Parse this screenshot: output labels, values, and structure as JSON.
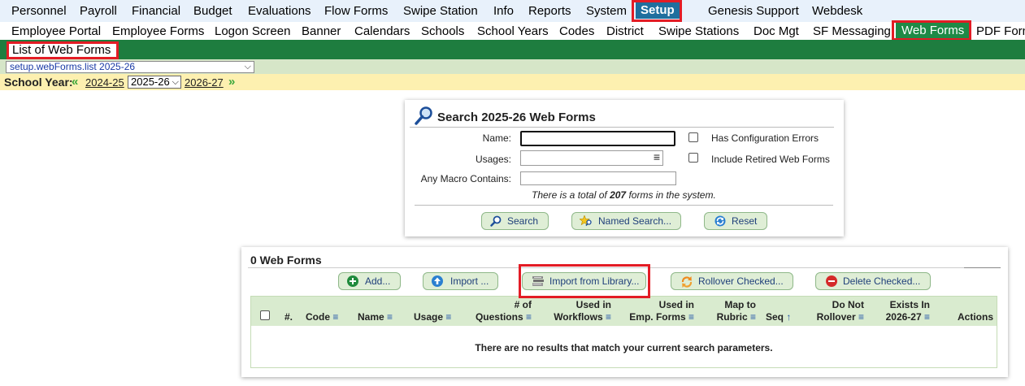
{
  "top_menu": [
    {
      "label": "Personnel"
    },
    {
      "label": "Payroll"
    },
    {
      "label": "Financial"
    },
    {
      "label": "Budget"
    },
    {
      "label": "Evaluations"
    },
    {
      "label": "Flow Forms"
    },
    {
      "label": "Swipe Station"
    },
    {
      "label": "Info"
    },
    {
      "label": "Reports"
    },
    {
      "label": "System"
    },
    {
      "label": "Setup"
    },
    {
      "label": "Genesis Support"
    },
    {
      "label": "Webdesk"
    }
  ],
  "sub_menu": [
    {
      "label": "Employee Portal"
    },
    {
      "label": "Employee Forms"
    },
    {
      "label": "Logon Screen"
    },
    {
      "label": "Banner"
    },
    {
      "label": "Calendars"
    },
    {
      "label": "Schools"
    },
    {
      "label": "School Years"
    },
    {
      "label": "Codes"
    },
    {
      "label": "District"
    },
    {
      "label": "Swipe Stations"
    },
    {
      "label": "Doc Mgt"
    },
    {
      "label": "SF Messaging"
    },
    {
      "label": "Web Forms"
    },
    {
      "label": "PDF Forms"
    }
  ],
  "page_title": "List of Web Forms",
  "page_selector": "setup.webForms.list 2025-26",
  "school_year": {
    "label": "School Year:",
    "prev": "2024-25",
    "current": "2025-26",
    "next": "2026-27"
  },
  "search": {
    "title": "Search 2025-26 Web Forms",
    "name_label": "Name:",
    "usages_label": "Usages:",
    "macro_label": "Any Macro Contains:",
    "has_config_errors": "Has Configuration Errors",
    "include_retired": "Include Retired Web Forms",
    "total_prefix": "There is a total of",
    "total_count": "207",
    "total_suffix": "forms in the system.",
    "search_btn": "Search",
    "named_search_btn": "Named Search...",
    "reset_btn": "Reset"
  },
  "list": {
    "title": "0 Web Forms",
    "add_btn": "Add...",
    "import_btn": "Import ...",
    "import_library_btn": "Import from Library...",
    "rollover_btn": "Rollover Checked...",
    "delete_btn": "Delete Checked...",
    "columns": {
      "num": "#.",
      "code": "Code",
      "name": "Name",
      "usage": "Usage",
      "questions_1": "# of",
      "questions_2": "Questions",
      "workflows_1": "Used in",
      "workflows_2": "Workflows",
      "empforms_1": "Used in",
      "empforms_2": "Emp. Forms",
      "rubric_1": "Map to",
      "rubric_2": "Rubric",
      "seq": "Seq",
      "rollover_1": "Do Not",
      "rollover_2": "Rollover",
      "exists_1": "Exists In",
      "exists_2": "2026-27",
      "actions": "Actions"
    },
    "empty_message": "There are no results that match your current search parameters."
  },
  "colors": {
    "setup_active": "#1f6f9e",
    "webforms_active": "#1e8a46",
    "green_bar": "#1e7d3f",
    "highlight_red": "#e31c25",
    "year_bar": "#fdf0b0",
    "button_bg": "#dfeed6"
  }
}
